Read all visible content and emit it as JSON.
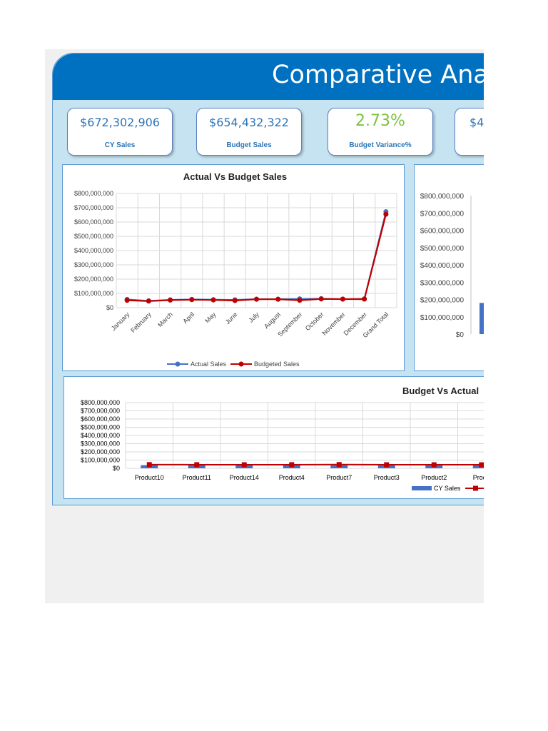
{
  "title": "Comparative Ana",
  "kpis": [
    {
      "value": "$672,302,906",
      "label": "CY Sales",
      "highlight": false
    },
    {
      "value": "$654,432,322",
      "label": "Budget Sales",
      "highlight": false
    },
    {
      "value": "2.73%",
      "label": "Budget Variance%",
      "highlight": true
    },
    {
      "value": "$4",
      "label": "",
      "highlight": false
    }
  ],
  "colors": {
    "banner": "#0070c0",
    "actual": "#4472c4",
    "budget": "#c00000",
    "kpi_green": "#7dc242",
    "background": "#c5e3f0"
  },
  "chart_data": [
    {
      "type": "line",
      "title": "Actual Vs Budget Sales",
      "categories": [
        "January",
        "February",
        "March",
        "April",
        "May",
        "June",
        "July",
        "August",
        "September",
        "October",
        "November",
        "December",
        "Grand Total"
      ],
      "series": [
        {
          "name": "Actual Sales",
          "values": [
            58000000,
            48000000,
            55000000,
            58000000,
            56000000,
            55000000,
            60000000,
            60000000,
            62000000,
            63000000,
            60000000,
            62000000,
            672302906
          ]
        },
        {
          "name": "Budgeted Sales",
          "values": [
            52000000,
            46000000,
            53000000,
            56000000,
            54000000,
            50000000,
            59000000,
            59000000,
            52000000,
            61000000,
            60000000,
            60000000,
            654432322
          ]
        }
      ],
      "ylim": [
        0,
        800000000
      ],
      "yticks": [
        "$0",
        "$100,000,000",
        "$200,000,000",
        "$300,000,000",
        "$400,000,000",
        "$500,000,000",
        "$600,000,000",
        "$700,000,000",
        "$800,000,000"
      ],
      "legend": "bottom",
      "grid": true
    },
    {
      "type": "bar",
      "title": "",
      "categories": [
        ""
      ],
      "series": [
        {
          "values": [
            180000000
          ]
        }
      ],
      "ylim": [
        0,
        800000000
      ],
      "yticks": [
        "$0",
        "$100,000,000",
        "$200,000,000",
        "$300,000,000",
        "$400,000,000",
        "$500,000,000",
        "$600,000,000",
        "$700,000,000",
        "$800,000,000"
      ],
      "grid": false
    },
    {
      "type": "bar",
      "title": "Budget Vs Actual",
      "categories": [
        "Product10",
        "Product11",
        "Product14",
        "Product4",
        "Product7",
        "Product3",
        "Product2",
        "Produ"
      ],
      "series": [
        {
          "name": "CY Sales",
          "values": [
            38000000,
            38000000,
            38000000,
            38000000,
            38000000,
            38000000,
            38000000,
            38000000
          ]
        },
        {
          "name": "",
          "values": [
            45000000,
            44000000,
            43000000,
            44000000,
            46000000,
            43000000,
            43000000,
            43000000
          ]
        }
      ],
      "ylim": [
        0,
        800000000
      ],
      "yticks": [
        "$0",
        "$100,000,000",
        "$200,000,000",
        "$300,000,000",
        "$400,000,000",
        "$500,000,000",
        "$600,000,000",
        "$700,000,000",
        "$800,000,000"
      ],
      "legend": "bottom",
      "grid": true
    }
  ]
}
